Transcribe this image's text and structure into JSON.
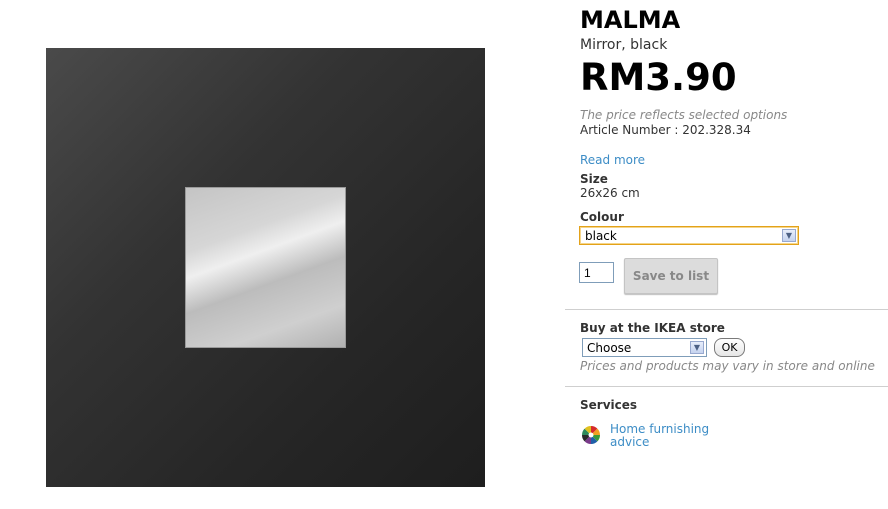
{
  "product": {
    "name": "MALMA",
    "description": "Mirror, black",
    "price": "RM3.90",
    "price_note": "The price reflects selected options",
    "article_number": "Article Number : 202.328.34",
    "read_more": "Read more",
    "size_label": "Size",
    "size_value": "26x26 cm",
    "colour_label": "Colour",
    "colour_selected": "black",
    "quantity": "1",
    "save_label": "Save to list"
  },
  "store": {
    "label": "Buy at the IKEA store",
    "select_value": "Choose",
    "ok_label": "OK",
    "note": "Prices and products may vary in store and online"
  },
  "services": {
    "label": "Services",
    "items": [
      {
        "icon": "home-furnishing-icon",
        "label": "Home furnishing advice"
      }
    ]
  },
  "colors": {
    "link": "#3d8dc6",
    "select_focus_border": "#e3a21a",
    "muted_text": "#888888"
  }
}
